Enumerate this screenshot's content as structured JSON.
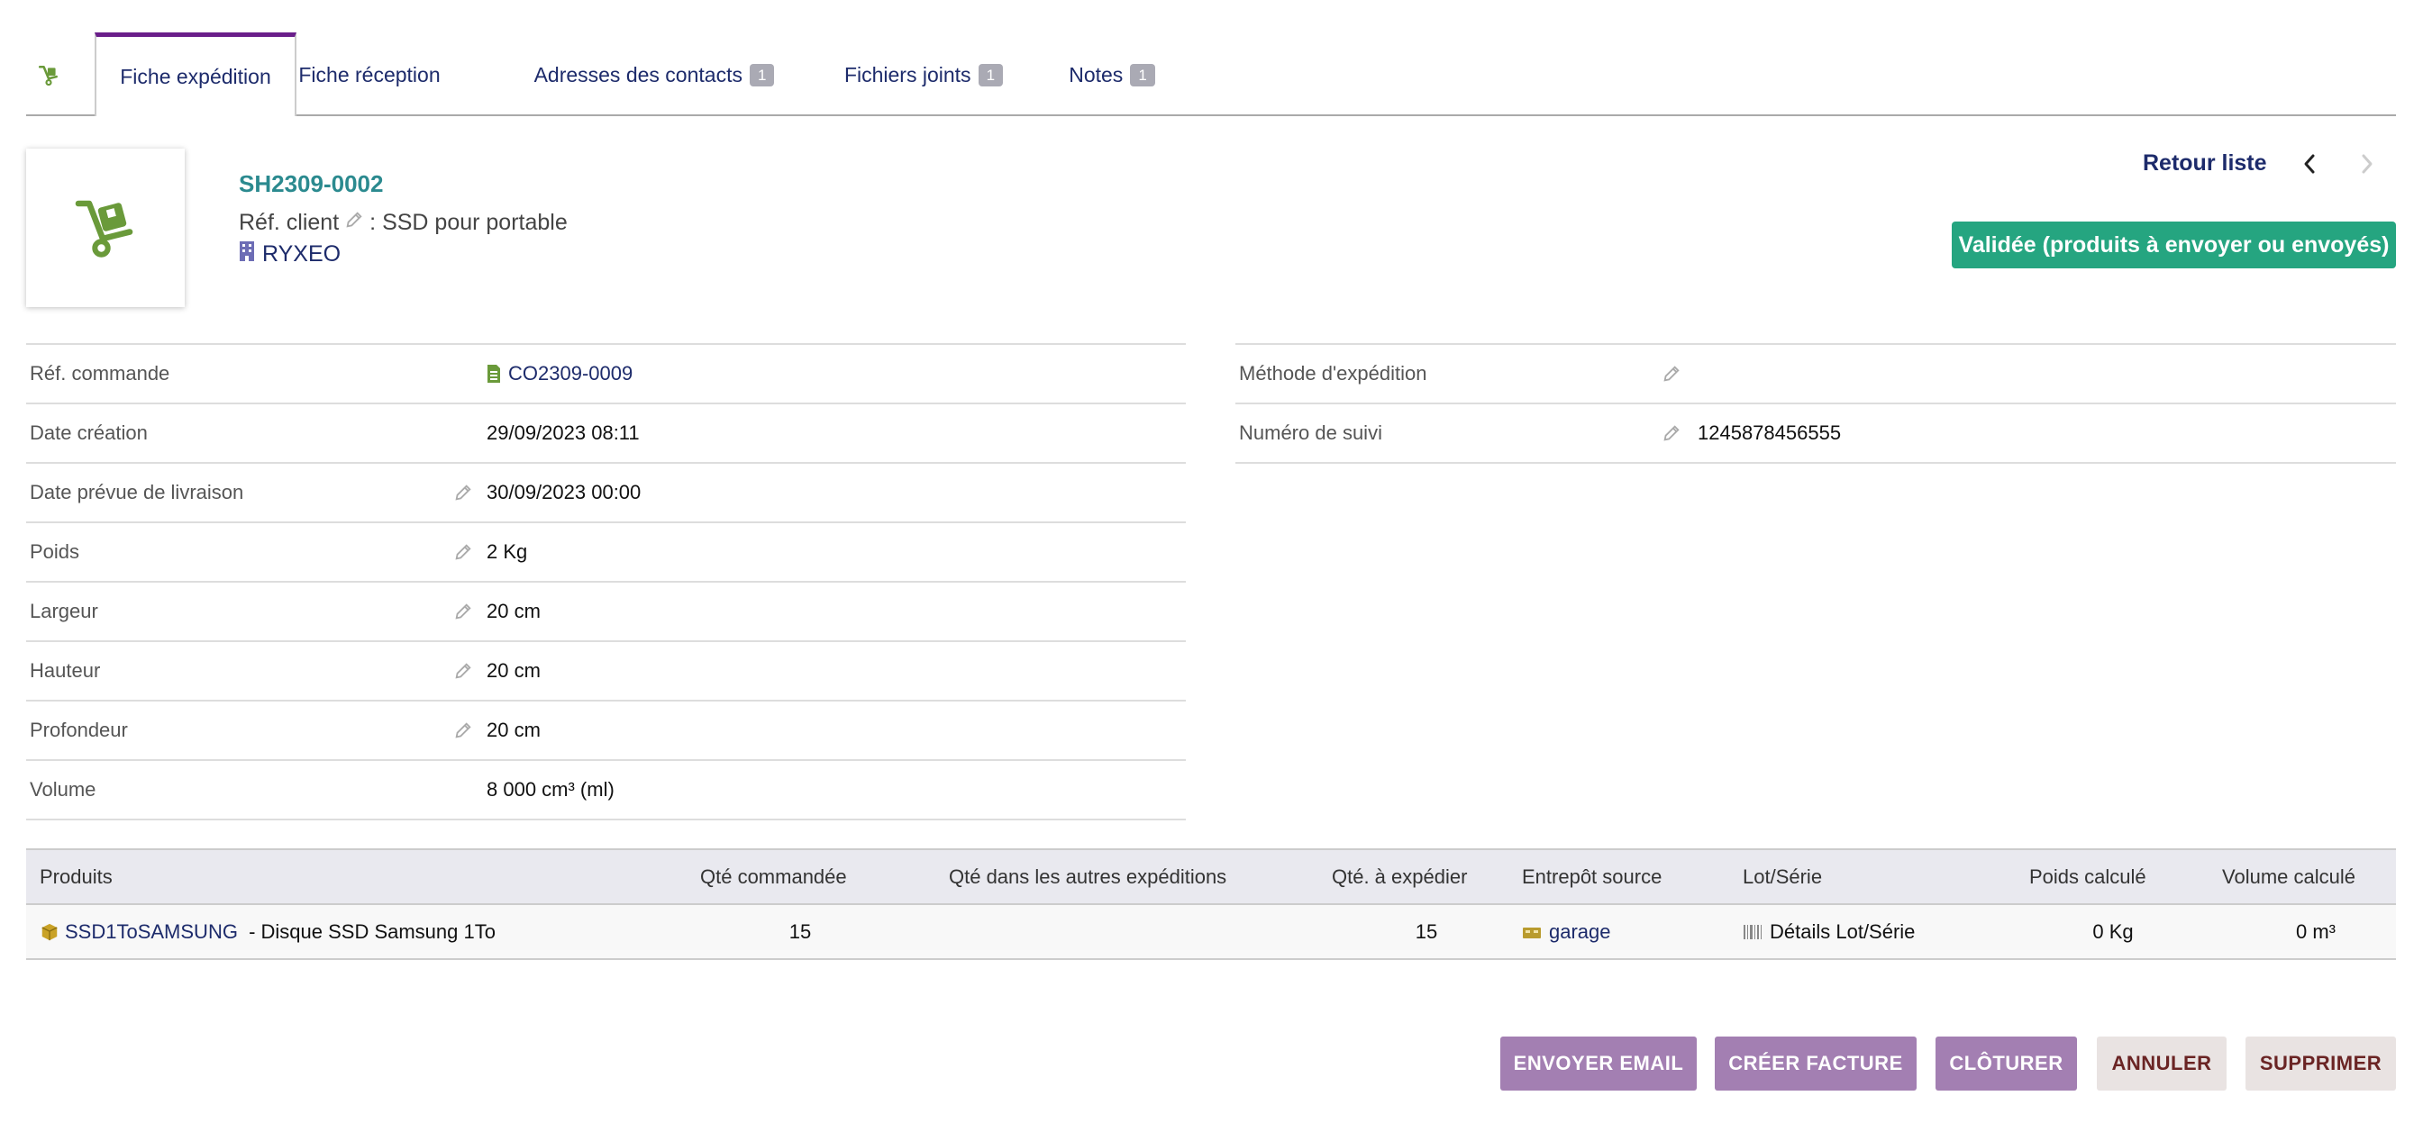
{
  "tabs": [
    {
      "label": "Fiche expédition",
      "badge": ""
    },
    {
      "label": "Fiche réception",
      "badge": ""
    },
    {
      "label": "Adresses des contacts",
      "badge": "1"
    },
    {
      "label": "Fichiers joints",
      "badge": "1"
    },
    {
      "label": "Notes",
      "badge": "1"
    }
  ],
  "header": {
    "ref": "SH2309-0002",
    "ref_client_label": "Réf. client",
    "ref_client_value": ": SSD pour portable",
    "company": "RYXEO",
    "back_list": "Retour liste",
    "status": "Validée (produits à envoyer ou envoyés)"
  },
  "left_fields": [
    {
      "label": "Réf. commande",
      "value": "CO2309-0009"
    },
    {
      "label": "Date création",
      "value": "29/09/2023 08:11"
    },
    {
      "label": "Date prévue de livraison",
      "value": "30/09/2023 00:00"
    },
    {
      "label": "Poids",
      "value": "2 Kg"
    },
    {
      "label": "Largeur",
      "value": "20 cm"
    },
    {
      "label": "Hauteur",
      "value": "20 cm"
    },
    {
      "label": "Profondeur",
      "value": "20 cm"
    },
    {
      "label": "Volume",
      "value": "8 000 cm³ (ml)"
    }
  ],
  "right_fields": [
    {
      "label": "Méthode d'expédition",
      "value": ""
    },
    {
      "label": "Numéro de suivi",
      "value": "1245878456555"
    }
  ],
  "products": {
    "headers": [
      "Produits",
      "Qté commandée",
      "Qté dans les autres expéditions",
      "Qté. à expédier",
      "Entrepôt source",
      "Lot/Série",
      "Poids calculé",
      "Volume calculé"
    ],
    "rows": [
      {
        "product_ref": "SSD1ToSAMSUNG",
        "product_label": " - Disque SSD Samsung 1To",
        "qty_ordered": "15",
        "qty_other": "",
        "qty_to_ship": "15",
        "warehouse": "garage",
        "lot": "Détails Lot/Série",
        "weight": "0 Kg",
        "volume": "0 m³"
      }
    ]
  },
  "actions": {
    "send_email": "ENVOYER EMAIL",
    "create_invoice": "CRÉER FACTURE",
    "close": "CLÔTURER",
    "cancel": "ANNULER",
    "delete": "SUPPRIMER"
  },
  "colors": {
    "accent": "#6a1e8a",
    "status": "#25a580",
    "link": "#1d2b6b",
    "ref": "#2b8a8f",
    "button_primary": "#a37fb2"
  }
}
